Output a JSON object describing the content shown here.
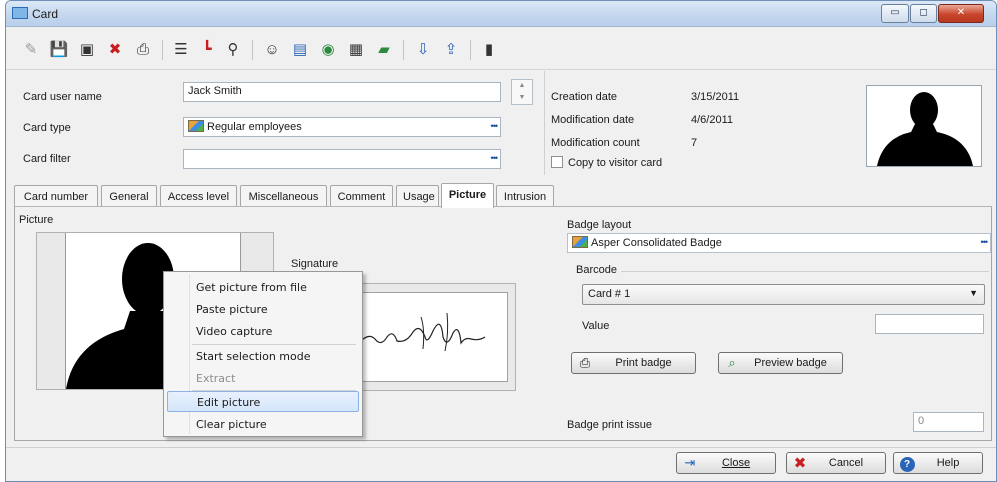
{
  "window": {
    "title": "Card",
    "minimize_label": "▭",
    "maximize_label": "◻",
    "close_label": "✕"
  },
  "toolbar": {
    "buttons": [
      {
        "name": "new-icon",
        "glyph": "✎"
      },
      {
        "name": "save-icon",
        "glyph": "💾"
      },
      {
        "name": "save-close-icon",
        "glyph": "▣"
      },
      {
        "name": "delete-icon",
        "glyph": "✖"
      },
      {
        "name": "print-icon",
        "glyph": "⎙"
      },
      {
        "name": "list-icon",
        "glyph": "☰"
      },
      {
        "name": "tree-icon",
        "glyph": "┗"
      },
      {
        "name": "search-icon",
        "glyph": "⚲"
      },
      {
        "name": "user-icon",
        "glyph": "☺"
      },
      {
        "name": "report-icon",
        "glyph": "▤"
      },
      {
        "name": "status-icon",
        "glyph": "◉"
      },
      {
        "name": "grid-icon",
        "glyph": "▦"
      },
      {
        "name": "chart-icon",
        "glyph": "▰"
      },
      {
        "name": "import-icon",
        "glyph": "⇩"
      },
      {
        "name": "export-icon",
        "glyph": "⇪"
      },
      {
        "name": "card-icon",
        "glyph": "▮"
      }
    ]
  },
  "form": {
    "user_name_label": "Card user name",
    "user_name_value": "Jack Smith",
    "card_type_label": "Card type",
    "card_type_value": "Regular employees",
    "card_filter_label": "Card filter",
    "card_filter_value": "",
    "browse": "•••"
  },
  "info": {
    "creation_date_label": "Creation date",
    "creation_date_value": "3/15/2011",
    "modification_date_label": "Modification date",
    "modification_date_value": "4/6/2011",
    "modification_count_label": "Modification count",
    "modification_count_value": "7",
    "copy_visitor_label": "Copy to visitor card"
  },
  "tabs": [
    "Card number",
    "General",
    "Access level",
    "Miscellaneous",
    "Comment",
    "Usage",
    "Picture",
    "Intrusion"
  ],
  "picture_tab": {
    "picture_label": "Picture",
    "signature_label": "Signature",
    "badge_layout_label": "Badge layout",
    "badge_layout_value": "Asper Consolidated Badge",
    "barcode_label": "Barcode",
    "barcode_value": "Card # 1",
    "value_label": "Value",
    "value_value": "",
    "print_badge": "Print badge",
    "preview_badge": "Preview badge",
    "badge_print_issue_label": "Badge print issue",
    "badge_print_issue_value": "0"
  },
  "context_menu": {
    "items": [
      {
        "label": "Get picture from file",
        "state": "normal"
      },
      {
        "label": "Paste picture",
        "state": "normal"
      },
      {
        "label": "Video capture",
        "state": "normal"
      },
      {
        "label": "Start selection mode",
        "state": "normal"
      },
      {
        "label": "Extract",
        "state": "disabled"
      },
      {
        "label": "Edit picture",
        "state": "highlighted"
      },
      {
        "label": "Clear picture",
        "state": "normal"
      }
    ]
  },
  "footer": {
    "close": "Close",
    "cancel": "Cancel",
    "help": "Help"
  }
}
